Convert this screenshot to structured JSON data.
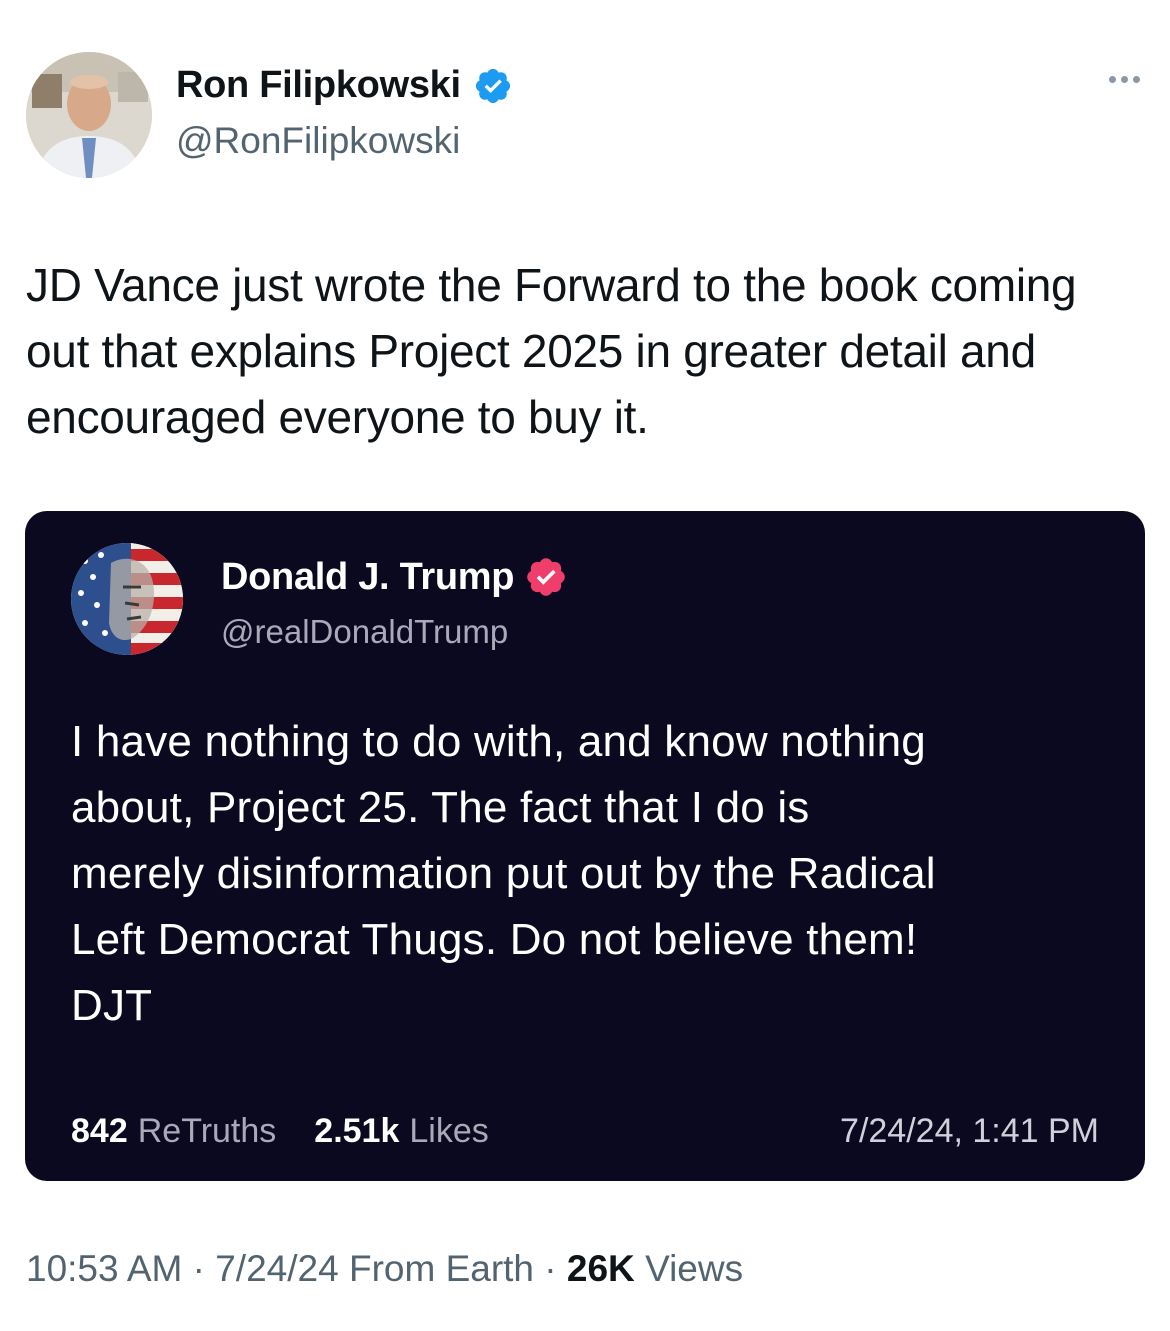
{
  "author": {
    "name": "Ron Filipkowski",
    "handle": "@RonFilipkowski",
    "verified_color": "#1d9bf0",
    "avatar_icon": "profile-photo"
  },
  "more_icon": "ellipsis-icon",
  "tweet": {
    "text": "JD Vance just wrote the Forward to the book coming out that explains Project 2025 in greater detail and encouraged everyone to buy it."
  },
  "embedded_post": {
    "name": "Donald J. Trump",
    "handle": "@realDonaldTrump",
    "verified_color": "#ef3e6b",
    "avatar_icon": "flag-portrait",
    "lines": [
      "I have nothing to do with, and know nothing",
      "about, Project 25. The fact that I do is",
      "merely disinformation put out by the Radical",
      "Left Democrat Thugs. Do not believe them!",
      "DJT"
    ],
    "retruths_count": "842",
    "retruths_label": "ReTruths",
    "likes_count": "2.51k",
    "likes_label": "Likes",
    "timestamp": "7/24/24, 1:41 PM",
    "background": "#0b0920"
  },
  "meta": {
    "time": "10:53 AM",
    "separator": "·",
    "date": "7/24/24",
    "source": "From Earth",
    "views_count": "26K",
    "views_label": "Views"
  }
}
